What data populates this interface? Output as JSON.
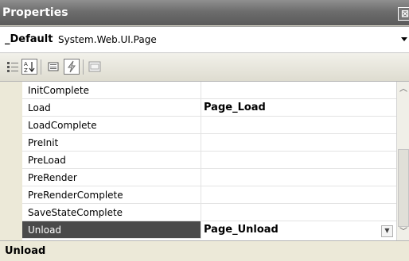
{
  "window": {
    "title": "Properties",
    "close_glyph": "⊠"
  },
  "object_selector": {
    "name": "_Default",
    "type": "System.Web.UI.Page"
  },
  "toolbar": {
    "buttons": [
      {
        "icon": "categorized-icon",
        "active": false
      },
      {
        "icon": "alphabetical-icon",
        "active": true
      },
      {
        "icon": "properties-icon",
        "active": false
      },
      {
        "icon": "events-icon",
        "active": true
      },
      {
        "icon": "property-pages-icon",
        "active": false
      }
    ]
  },
  "grid": {
    "rows": [
      {
        "name": "InitComplete",
        "value": ""
      },
      {
        "name": "Load",
        "value": "Page_Load"
      },
      {
        "name": "LoadComplete",
        "value": ""
      },
      {
        "name": "PreInit",
        "value": ""
      },
      {
        "name": "PreLoad",
        "value": ""
      },
      {
        "name": "PreRender",
        "value": ""
      },
      {
        "name": "PreRenderComplete",
        "value": ""
      },
      {
        "name": "SaveStateComplete",
        "value": ""
      },
      {
        "name": "Unload",
        "value": "Page_Unload",
        "selected": true
      }
    ]
  },
  "description": {
    "title": "Unload"
  },
  "colors": {
    "title_bar": "#6d6d6d",
    "selected_row": "#4a4a4a"
  }
}
